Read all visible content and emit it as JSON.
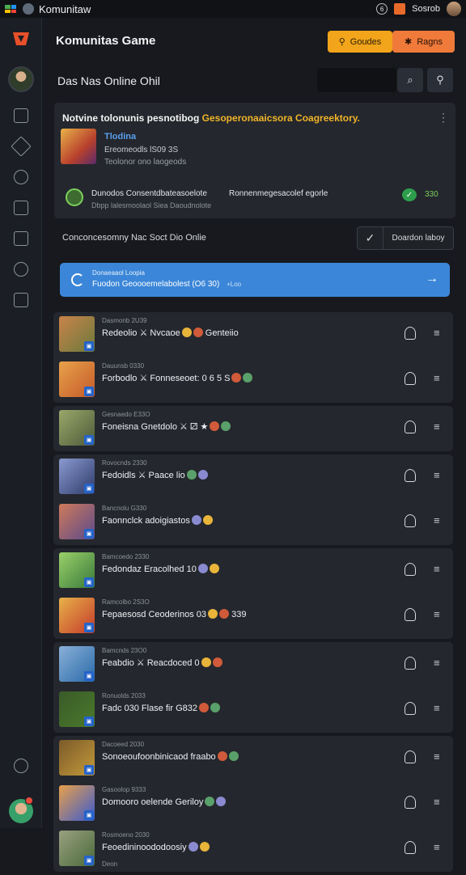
{
  "window": {
    "title": "Komunitaw",
    "right_label": "Sosrob"
  },
  "header": {
    "title": "Komunitas Game",
    "btn_primary": "Goudes",
    "btn_secondary": "Ragns"
  },
  "subheader": {
    "title": "Das Nas Online Ohil"
  },
  "featured": {
    "headline_white": "Notvine tolonunis pesnotibog",
    "headline_yellow": "Gesoperonaaicsora Coagreektory.",
    "game_name": "Tlodina",
    "meta1": "Ereomeodls lS09 3S",
    "meta2": "Teolonor ono laogeods",
    "line_a": "Dunodos Consentdbateasoelote",
    "line_a2": "Ronnenmegesacolef egorle",
    "line_b": "Dbpp lalesmoolaol Siea Daoudnolote",
    "count": "330"
  },
  "filter": {
    "text": "Conconcesomny Nac Soct Dio Onlie",
    "button": "Doardon laboy"
  },
  "banner": {
    "line1": "Donaeaaol Loopia",
    "line2": "Fuodon Geoooemelabolest (O6 30)",
    "tag": "+Loo"
  },
  "groups": [
    [
      {
        "meta": "Dasmonb 2U39",
        "name": "Redeolio ⚔ Nvcaoe",
        "name2": "Genteiio",
        "thumb": "#6b7a3c",
        "thumb2": "#c9834a"
      },
      {
        "meta": "Dauunsb 0330",
        "name": "Forbodlo ⚔ Fonneseoet: 0 6 5 S",
        "name2": "",
        "thumb": "#c45a2a",
        "thumb2": "#e8a24a"
      }
    ],
    [
      {
        "meta": "Gesnaedo E33O",
        "name": "Foneisna Gnetdolo ⚔ ⚂ ★",
        "name2": "",
        "thumb": "#4d5a3a",
        "thumb2": "#9aa86a"
      }
    ],
    [
      {
        "meta": "Rovocnds 2330",
        "name": "Fedoidls ⚔ Paace lio",
        "name2": "",
        "thumb": "#2e3b6a",
        "thumb2": "#8a9ad0"
      },
      {
        "meta": "Bancnolu G330",
        "name": "Faonnclck adoigiastos",
        "name2": "",
        "thumb": "#5a4a8a",
        "thumb2": "#d07a5a"
      }
    ],
    [
      {
        "meta": "Bamcoedo 2330",
        "name": "Fedondaz Eracolhed 10",
        "name2": "",
        "thumb": "#3a7a3a",
        "thumb2": "#9ad06a"
      },
      {
        "meta": "Ramcolbo 2S3O",
        "name": "Fepaesosd Ceoderinos 03",
        "name2": "339",
        "thumb": "#c43a2a",
        "thumb2": "#e8b24a"
      }
    ],
    [
      {
        "meta": "Bamcnds 23O0",
        "name": "Feabdio ⚔ Reacdoced 0",
        "name2": "",
        "thumb": "#2a6aa8",
        "thumb2": "#8ab0d8"
      },
      {
        "meta": "Ronuolds 2033",
        "name": "Fadc 030 Flase fir G832",
        "name2": "",
        "thumb": "#4a7a2a",
        "thumb2": "#3a5a2a"
      }
    ],
    [
      {
        "meta": "Dacoeed 2030",
        "name": "Sonoeoufoonbinicaod fraabo",
        "name2": "",
        "thumb": "#c49a3a",
        "thumb2": "#7a5a2a"
      },
      {
        "meta": "Gasoolop 9333",
        "name": "Domooro oelende Geriloy",
        "name2": "",
        "thumb": "#3a5ad0",
        "thumb2": "#e8a04a"
      },
      {
        "meta": "Rosmoeno 2030",
        "name": "Feoedininoododoosiy",
        "name2": "",
        "sub": "Deon",
        "thumb": "#4a6a3a",
        "thumb2": "#9aa080"
      }
    ]
  ],
  "colors": {
    "accent_blue": "#3b86d8",
    "button_yellow": "#f2a41a",
    "button_orange": "#f07a3a",
    "highlight_yellow": "#f0b429",
    "online_green": "#7ccf5d"
  },
  "icons": [
    "menu-icon",
    "search-icon",
    "home-icon",
    "gamepad-icon",
    "settings-icon",
    "edit-icon",
    "chat-icon",
    "clock-icon",
    "notification-icon",
    "user-icon",
    "check-icon",
    "refresh-icon",
    "arrow-right-icon"
  ]
}
